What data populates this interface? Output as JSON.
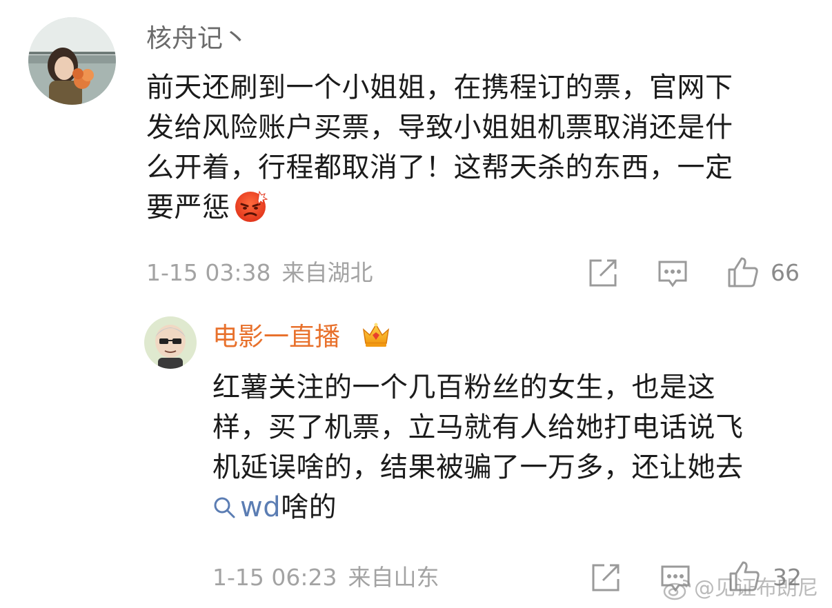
{
  "comments": [
    {
      "username": "核舟记丶",
      "body_lines": [
        "前天还刷到一个小姐姐，在携程订的票，官网下",
        "发给风险账户买票，导致小姐姐机票取消还是什",
        "么开着，行程都取消了！这帮天杀的东西，一定",
        "要严惩"
      ],
      "emoji": "angry-face-emoji",
      "time": "1-15 03:38",
      "location": "来自湖北",
      "likes": "66"
    },
    {
      "username": "电影一直播",
      "badge": "crown-badge-icon",
      "body_lines": [
        "红薯关注的一个几百粉丝的女生，也是这",
        "样，买了机票，立马就有人给她打电话说飞",
        "机延误啥的，结果被骗了一万多，还让她去"
      ],
      "search_term": "wd",
      "search_suffix": "啥的",
      "time": "1-15 06:23",
      "location": "来自山东",
      "likes": "32"
    }
  ],
  "watermark": "@见证布朗尼",
  "colors": {
    "username_gray": "#6b6b6b",
    "username_vip": "#e8712c",
    "meta": "#a3a3a3",
    "link": "#5b7db3",
    "icon": "#9a9a9a"
  },
  "icons": [
    "share-icon",
    "comment-icon",
    "like-icon",
    "search-icon",
    "weibo-logo-icon"
  ]
}
